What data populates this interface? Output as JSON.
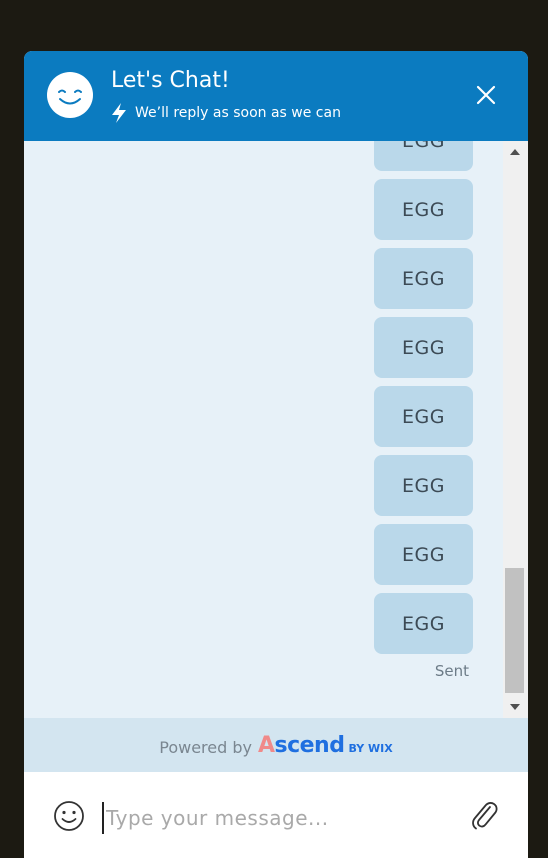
{
  "header": {
    "title": "Let's Chat!",
    "subtitle": "We’ll reply as soon as we can",
    "background": "#0b7bc0"
  },
  "messages": [
    {
      "text": "EGG"
    },
    {
      "text": "EGG"
    },
    {
      "text": "EGG"
    },
    {
      "text": "EGG"
    },
    {
      "text": "EGG"
    },
    {
      "text": "EGG"
    },
    {
      "text": "EGG"
    },
    {
      "text": "EGG"
    }
  ],
  "status": {
    "sent": "Sent"
  },
  "footer": {
    "powered_by": "Powered by",
    "brand": "scend",
    "brand_initial": "A",
    "brand_suffix": "BY WIX"
  },
  "composer": {
    "placeholder": "Type your message...",
    "value": ""
  },
  "icons": {
    "avatar": "smiley-face-icon",
    "lightning": "lightning-bolt-icon",
    "close": "close-icon",
    "emoji": "emoji-icon",
    "attach": "paperclip-icon"
  }
}
